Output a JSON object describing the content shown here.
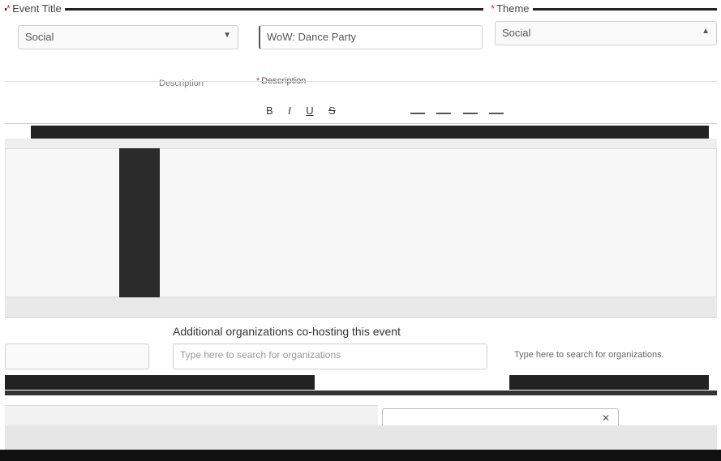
{
  "form": {
    "event_title_label": "Event Title",
    "theme_label": "Theme",
    "organization_value": "Social",
    "event_title_value": "WoW: Dance Party",
    "theme_value": "Social",
    "description_label_left": "Description",
    "description_label_right": "Description",
    "cohost_label": "Additional organizations co-hosting this event",
    "cohost_placeholder": "Type here to search for organizations",
    "cohost_helper": "Type here to search for organizations."
  },
  "toolbar": {
    "items": [
      "B",
      "I",
      "U",
      "S"
    ]
  },
  "colors": {
    "required": "#dd3333",
    "rule": "#222222",
    "footer": "#111111"
  }
}
